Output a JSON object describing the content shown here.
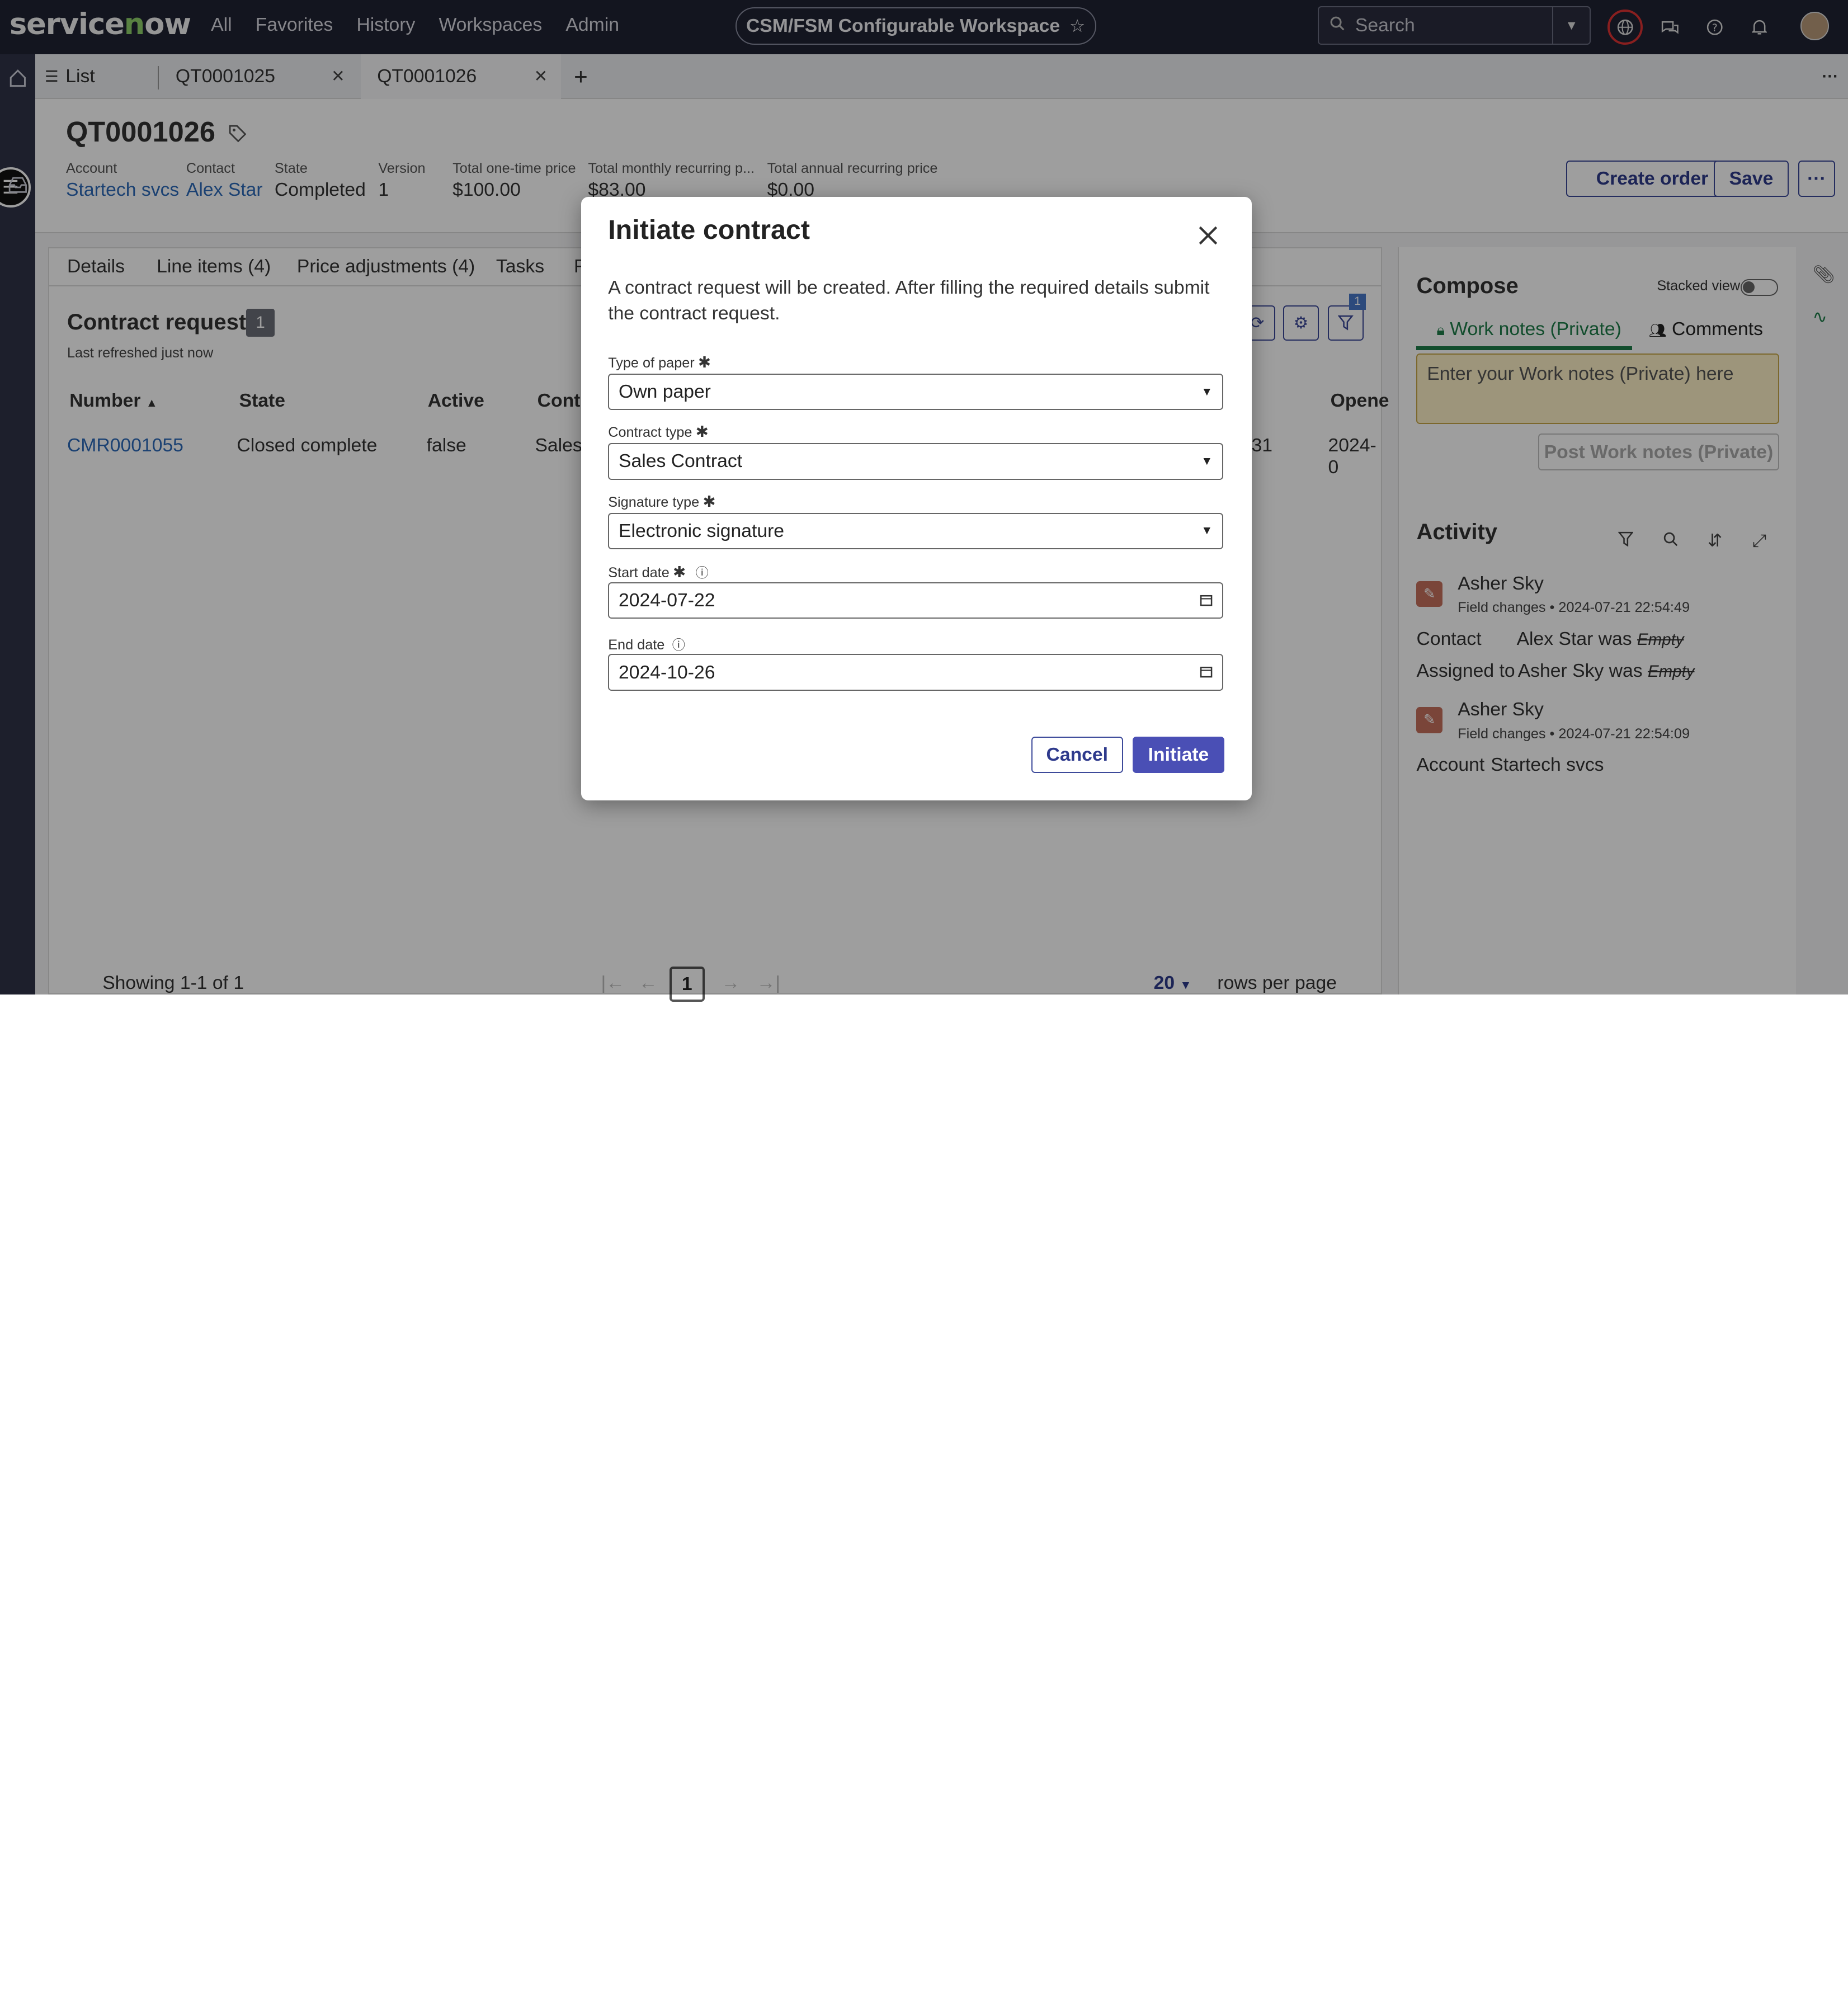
{
  "topbar": {
    "logo": "servicenow",
    "nav": [
      "All",
      "Favorites",
      "History",
      "Workspaces",
      "Admin"
    ],
    "workspace": "CSM/FSM Configurable Workspace",
    "search_placeholder": "Search"
  },
  "tabs": {
    "list_label": "List",
    "tab1": "QT0001025",
    "tab2": "QT0001026"
  },
  "record": {
    "title": "QT0001026",
    "fields": [
      {
        "label": "Account",
        "value": "Startech svcs"
      },
      {
        "label": "Contact",
        "value": "Alex Star"
      },
      {
        "label": "State",
        "value": "Completed"
      },
      {
        "label": "Version",
        "value": "1"
      },
      {
        "label": "Total one-time price",
        "value": "$100.00"
      },
      {
        "label": "Total monthly recurring p...",
        "value": "$83.00"
      },
      {
        "label": "Total annual recurring price",
        "value": "$0.00"
      }
    ],
    "create_order": "Create order",
    "save": "Save",
    "more": "···"
  },
  "subtabs": [
    "Details",
    "Line items (4)",
    "Price adjustments (4)",
    "Tasks",
    "R"
  ],
  "contract_requests": {
    "title": "Contract requests",
    "count": "1",
    "refreshed": "Last refreshed just now",
    "filter_badge": "1",
    "columns": [
      "Number",
      "State",
      "Active",
      "Contr",
      "Opene"
    ],
    "row": {
      "number": "CMR0001055",
      "state": "Closed complete",
      "active": "false",
      "contract": "Sales",
      "c31": "31",
      "opened": "2024-0"
    },
    "showing": "Showing 1-1 of 1",
    "page": "1",
    "rows": "20",
    "rows_label": "rows per page"
  },
  "compose": {
    "title": "Compose",
    "stacked_view": "Stacked view",
    "tab_work_notes": "Work notes (Private)",
    "tab_comments": "Comments",
    "placeholder": "Enter your Work notes (Private) here",
    "post": "Post Work notes (Private)"
  },
  "activity": {
    "title": "Activity",
    "entries": [
      {
        "name": "Asher Sky",
        "meta": "Field changes • 2024-07-21 22:54:49"
      },
      {
        "name": "Asher Sky",
        "meta": "Field changes • 2024-07-21 22:54:09"
      }
    ],
    "c1_label": "Contact",
    "c1_value": "Alex Star was",
    "c1_old": "Empty",
    "c2_label": "Assigned to",
    "c2_value": "Asher Sky was",
    "c2_old": "Empty",
    "c3_label": "Account",
    "c3_value": "Startech svcs"
  },
  "modal": {
    "title": "Initiate contract",
    "description": "A contract request will be created. After filling the required details submit the contract request.",
    "fields": [
      {
        "label": "Type of paper",
        "value": "Own paper"
      },
      {
        "label": "Contract type",
        "value": "Sales Contract"
      },
      {
        "label": "Signature type",
        "value": "Electronic signature"
      },
      {
        "label": "Start date",
        "value": "2024-07-22"
      },
      {
        "label": "End date",
        "value": "2024-10-26"
      }
    ],
    "cancel": "Cancel",
    "initiate": "Initiate"
  }
}
